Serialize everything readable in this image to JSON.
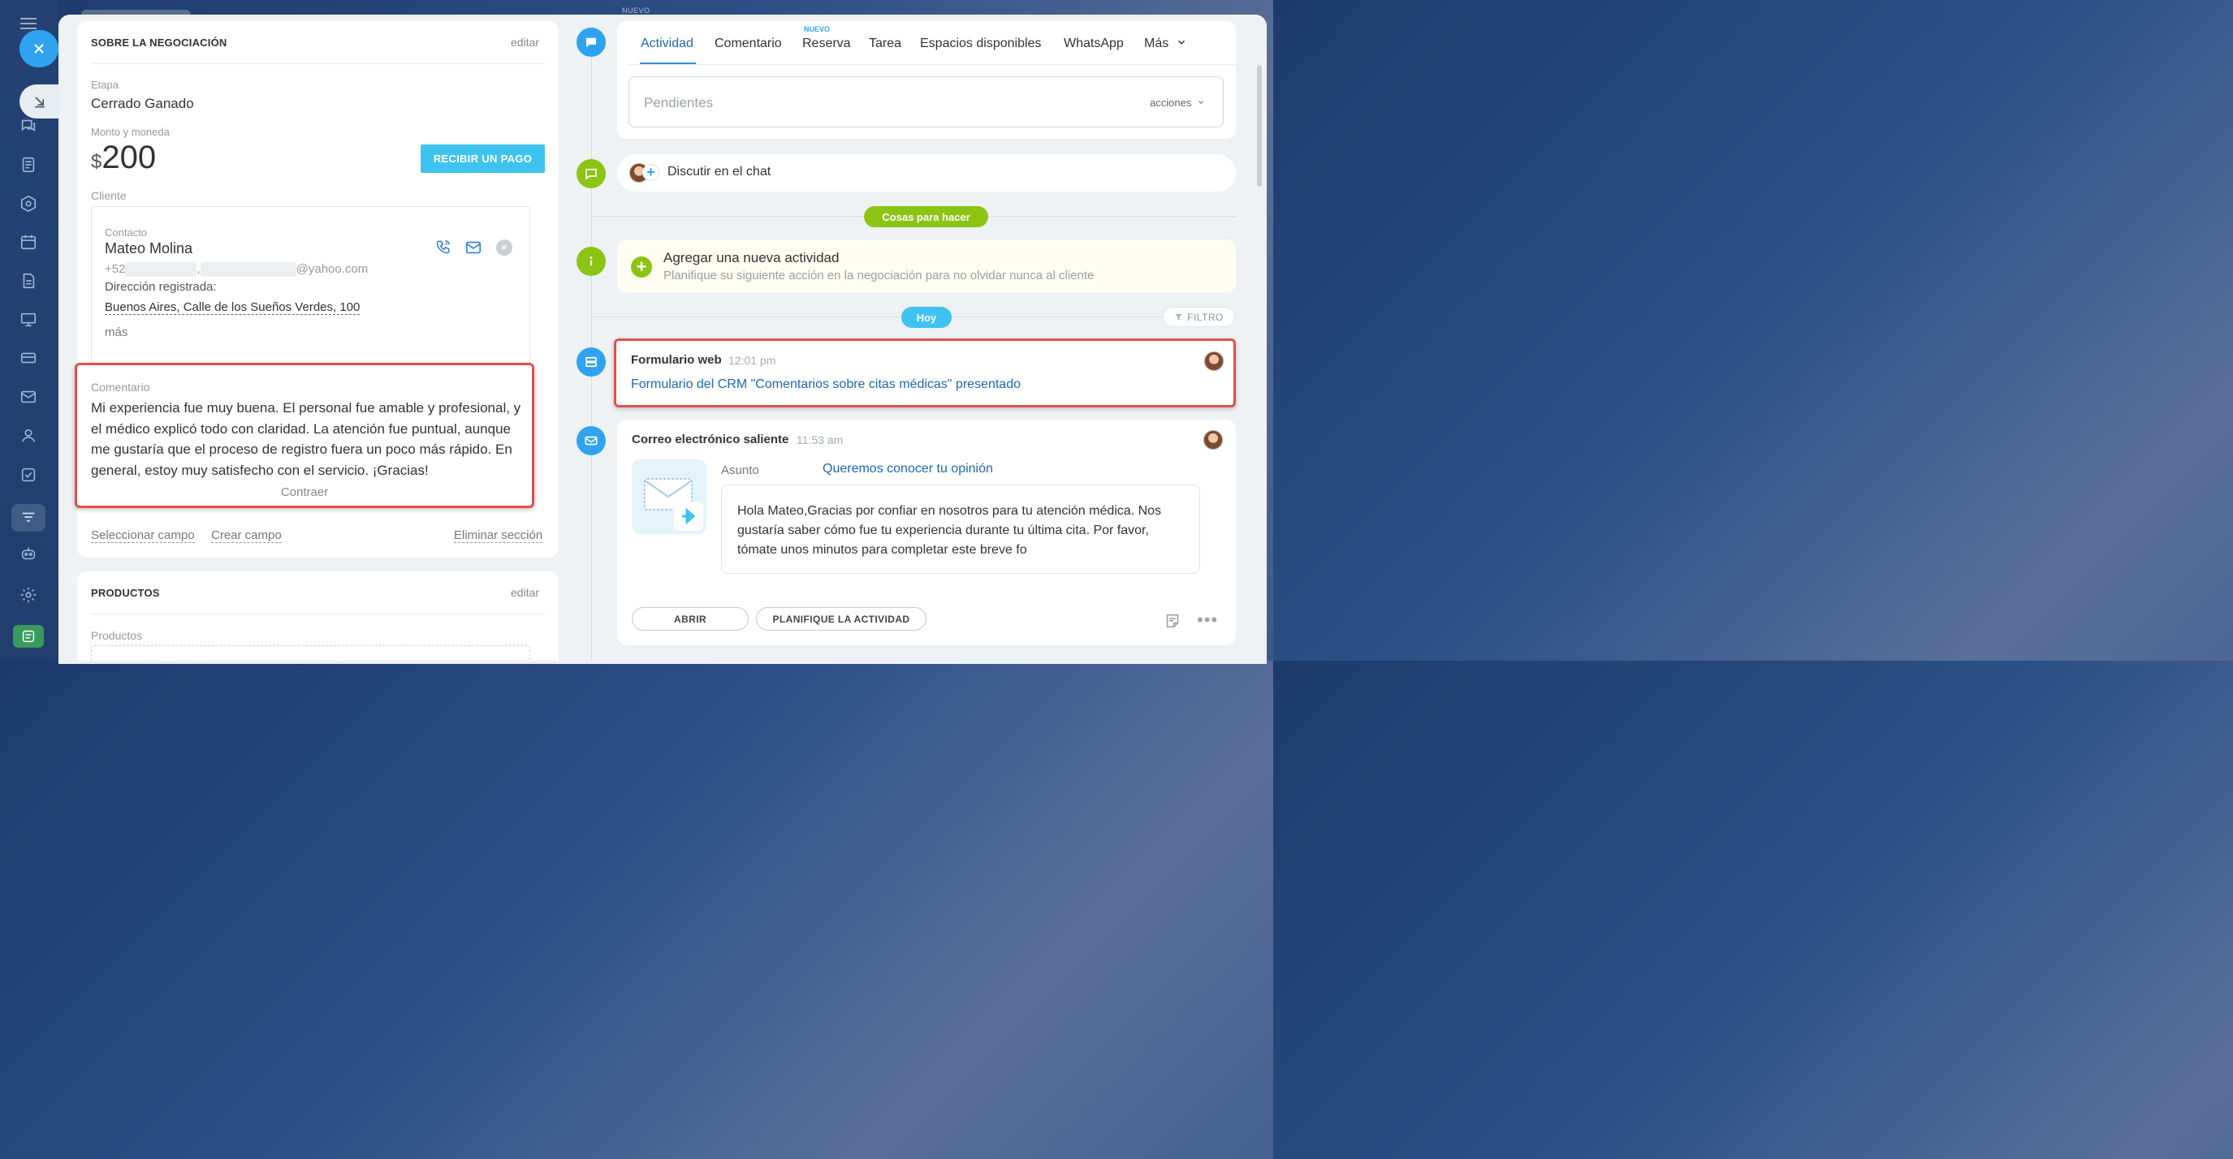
{
  "topbar": {
    "nuevo_label": "NUEVO"
  },
  "left": {
    "about_title": "SOBRE LA NEGOCIACIÓN",
    "edit_label": "editar",
    "stage_label": "Etapa",
    "stage_value": "Cerrado Ganado",
    "amount_label": "Monto y moneda",
    "currency_symbol": "$",
    "amount_value": "200",
    "pay_button": "RECIBIR UN PAGO",
    "client_label": "Cliente",
    "contact": {
      "label": "Contacto",
      "name": "Mateo Molina",
      "phone_prefix": "+52",
      "email_suffix": "@yahoo.com",
      "address_label": "Dirección registrada:",
      "address": "Buenos Aires, Calle de los Sueños Verdes, 100",
      "more": "más"
    },
    "comment": {
      "label": "Comentario",
      "text": "Mi experiencia fue muy buena. El personal fue amable y profesional, y el médico explicó todo con claridad. La atención fue puntual, aunque me gustaría que el proceso de registro fuera un poco más rápido. En general, estoy muy satisfecho con el servicio. ¡Gracias!",
      "collapse": "Contraer"
    },
    "select_field": "Seleccionar campo",
    "create_field": "Crear campo",
    "delete_section": "Eliminar sección",
    "products_title": "PRODUCTOS",
    "products_edit": "editar",
    "products_label": "Productos"
  },
  "right": {
    "tabs": [
      {
        "label": "Actividad",
        "active": true
      },
      {
        "label": "Comentario"
      },
      {
        "label": "Reserva",
        "badge": "NUEVO"
      },
      {
        "label": "Tarea"
      },
      {
        "label": "Espacios disponibles"
      },
      {
        "label": "WhatsApp"
      },
      {
        "label": "Más"
      }
    ],
    "pending_placeholder": "Pendientes",
    "actions_label": "acciones",
    "chat_label": "Discutir en el chat",
    "todo_pill": "Cosas para hacer",
    "new_activity_title": "Agregar una nueva actividad",
    "new_activity_sub": "Planifique su siguiente acción en la negociación para no olvidar nunca al cliente",
    "today_pill": "Hoy",
    "filter_label": "FILTRO",
    "webform": {
      "title": "Formulario web",
      "time": "12:01 pm",
      "link": "Formulario del CRM \"Comentarios sobre citas médicas\" presentado"
    },
    "email": {
      "title": "Correo electrónico saliente",
      "time": "11:53 am",
      "subject_label": "Asunto",
      "subject": "Queremos conocer tu opinión",
      "body": "Hola Mateo,Gracias por confiar en nosotros para tu atención médica. Nos gustaría saber cómo fue tu experiencia durante tu última cita. Por favor, tómate unos minutos para completar este breve fo",
      "open_button": "ABRIR",
      "plan_button": "PLANIFIQUE LA ACTIVIDAD"
    }
  },
  "colors": {
    "accent_blue": "#2fa3f0",
    "green": "#8cc413",
    "highlight_red": "#e2504a",
    "link_blue": "#2067b0"
  }
}
